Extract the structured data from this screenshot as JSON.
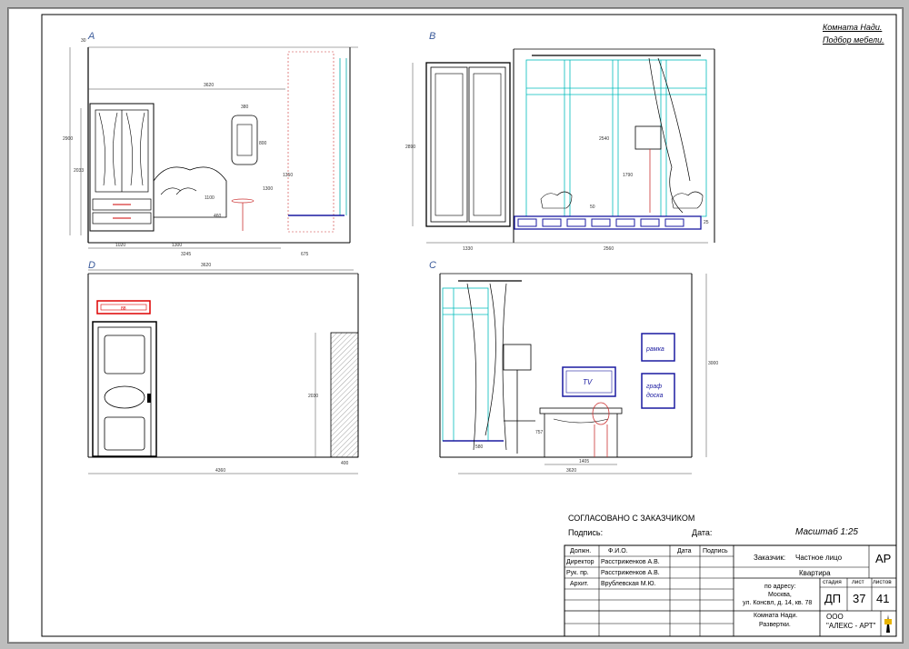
{
  "title_block": {
    "project_line1": "Комната Нади.",
    "project_line2": "Подбор мебели.",
    "agreed": "СОГЛАСОВАНО С ЗАКАЗЧИКОМ",
    "signature_label": "Подпись:",
    "date_label": "Дата:",
    "scale": "Масштаб   1:25",
    "headers": {
      "position": "Должн.",
      "name": "Ф.И.О.",
      "date": "Дата",
      "sign": "Подпись"
    },
    "rows": [
      {
        "position": "Директор",
        "name": "Расстриженков А.В."
      },
      {
        "position": "Рук. пр.",
        "name": "Расстриженков А.В."
      },
      {
        "position": "Архит.",
        "name": "Врублевская М.Ю."
      }
    ],
    "customer_label": "Заказчик:",
    "customer_value": "Частное лицо",
    "object": "Квартира",
    "address_l1": "по адресу:",
    "address_l2": "Москва,",
    "address_l3": "ул. Консвл, д. 14, кв. 78",
    "section": "АР",
    "stage_label": "стадия",
    "sheet_label": "лист",
    "sheets_label": "листов",
    "stage": "ДП",
    "sheet": "37",
    "sheets": "41",
    "drawing_name_l1": "Комната Нади.",
    "drawing_name_l2": "Развертки.",
    "company_l1": "ООО",
    "company_l2": "\"АЛЕКС - АРТ\""
  },
  "views": {
    "A": {
      "label": "A",
      "dims": {
        "top": "30",
        "width_total": "3620",
        "height_total": "2900",
        "cabinet_h": "2033",
        "mirror_w": "380",
        "mirror_h": "800",
        "h1": "1350",
        "h2": "1300",
        "h3": "1100",
        "h4": "460",
        "w1": "1020",
        "w2": "1300",
        "w3": "3245",
        "w4": "675"
      }
    },
    "B": {
      "label": "B",
      "dims": {
        "height": "2890",
        "curtain_h": "2540",
        "lamp_h": "1790",
        "small": "50",
        "w1": "1330",
        "w2": "2560",
        "small2": "25"
      }
    },
    "D": {
      "label": "D",
      "dims": {
        "top_w": "3620",
        "h": "2030",
        "w": "4360",
        "w2": "400"
      },
      "ac_label": "88"
    },
    "C": {
      "label": "C",
      "dims": {
        "h": "3000",
        "desk_h": "757",
        "w1": "1405",
        "w2": "3620",
        "small": "580"
      },
      "tv": "TV",
      "frame1": "рамка",
      "frame2_l1": "граф",
      "frame2_l2": "доска"
    }
  }
}
